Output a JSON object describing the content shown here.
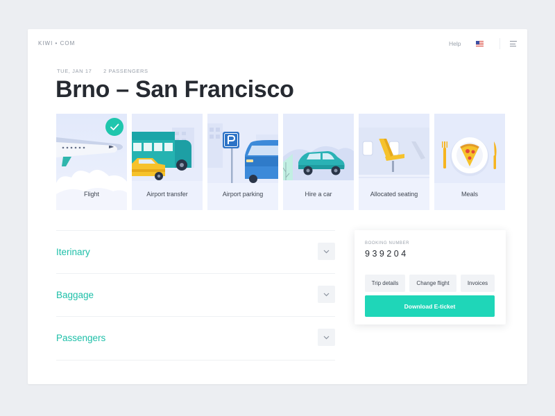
{
  "header": {
    "logo": "KIWI • COM",
    "help_label": "Help",
    "language_flag": "us-flag-icon",
    "menu_icon": "hamburger-menu-icon"
  },
  "trip": {
    "date": "TUE, JAN 17",
    "passengers": "2 PASSENGERS",
    "title": "Brno – San Francisco"
  },
  "services": [
    {
      "label": "Flight",
      "icon": "airplane-illustration",
      "selected": true
    },
    {
      "label": "Airport transfer",
      "icon": "bus-taxi-illustration",
      "selected": false
    },
    {
      "label": "Airport parking",
      "icon": "parking-illustration",
      "selected": false
    },
    {
      "label": "Hire a car",
      "icon": "car-illustration",
      "selected": false
    },
    {
      "label": "Allocated seating",
      "icon": "seat-illustration",
      "selected": false
    },
    {
      "label": "Meals",
      "icon": "pizza-plate-illustration",
      "selected": false
    }
  ],
  "accordion": [
    {
      "label": "Iterinary"
    },
    {
      "label": "Baggage"
    },
    {
      "label": "Passengers"
    }
  ],
  "booking": {
    "number_label": "BOOKING NUMBER",
    "number": "939204",
    "buttons": {
      "trip_details": "Trip details",
      "change_flight": "Change flight",
      "invoices": "Invoices"
    },
    "download_label": "Download E-ticket"
  },
  "colors": {
    "accent": "#1fc6ad",
    "download_button": "#1fd6b8",
    "title_text": "#262a31",
    "tile_background": "#e5ebfb",
    "page_background": "#eceef2"
  }
}
